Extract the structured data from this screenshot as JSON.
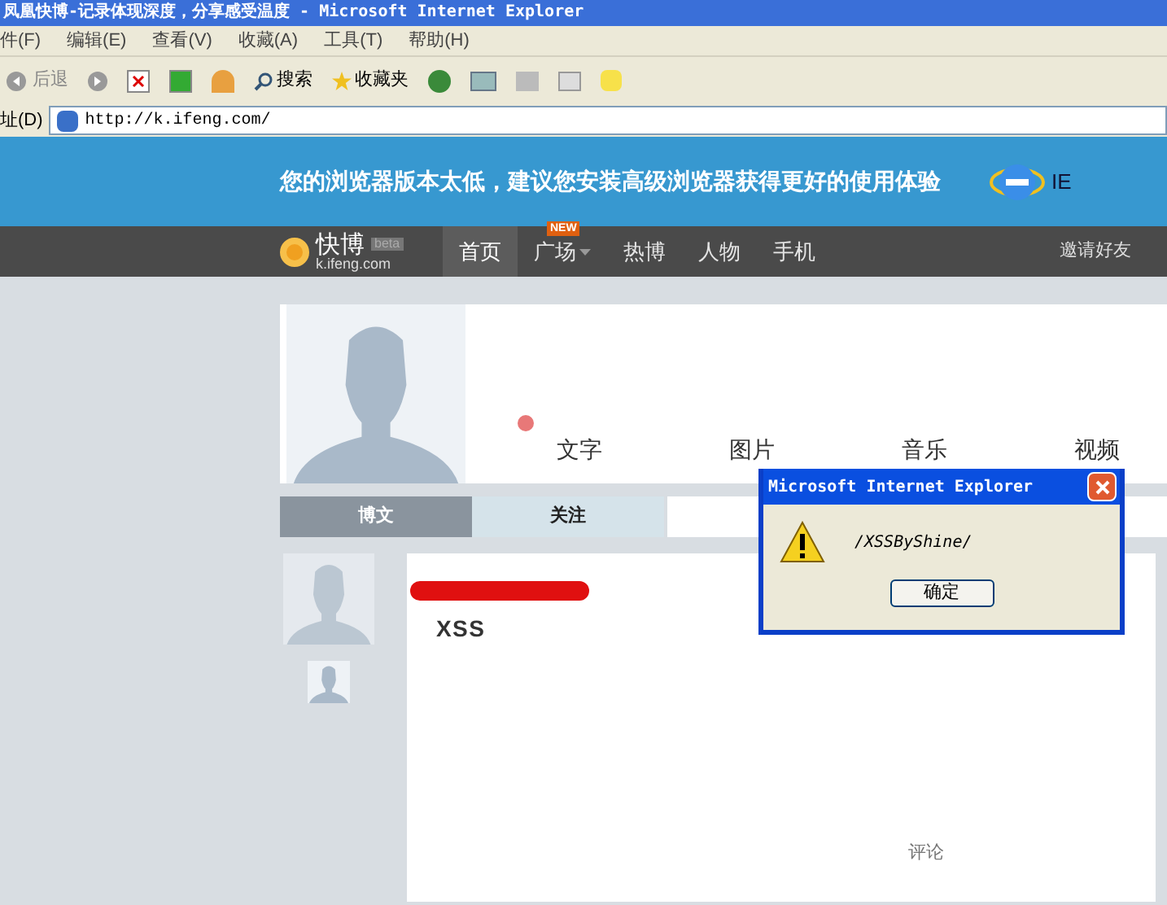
{
  "window": {
    "title": "凤凰快博-记录体现深度，分享感受温度 - Microsoft Internet Explorer"
  },
  "menu": [
    "件(F)",
    "编辑(E)",
    "查看(V)",
    "收藏(A)",
    "工具(T)",
    "帮助(H)"
  ],
  "toolbar": {
    "back": "后退",
    "search": "搜索",
    "favorites": "收藏夹"
  },
  "address": {
    "label": "址(D)",
    "value": "http://k.ifeng.com/"
  },
  "banner": {
    "text": "您的浏览器版本太低，建议您安装高级浏览器获得更好的使用体验",
    "browser": "IE"
  },
  "nav": {
    "logo": "快博",
    "logo_badge": "beta",
    "logo_domain": "k.ifeng.com",
    "items": [
      {
        "label": "首页",
        "selected": true
      },
      {
        "label": "广场",
        "selected": false,
        "badge": "NEW"
      },
      {
        "label": "热博",
        "selected": false
      },
      {
        "label": "人物",
        "selected": false
      },
      {
        "label": "手机",
        "selected": false
      }
    ],
    "right": "邀请好友"
  },
  "media_tabs": [
    "文字",
    "图片",
    "音乐",
    "视频"
  ],
  "profile_tabs": [
    {
      "label": "博文",
      "selected": true
    },
    {
      "label": "关注",
      "selected": false
    }
  ],
  "post": {
    "text": "XSS",
    "actions": [
      "评论"
    ]
  },
  "dialog": {
    "title": "Microsoft Internet Explorer",
    "message": "/XSSByShine/",
    "button": "确定"
  }
}
